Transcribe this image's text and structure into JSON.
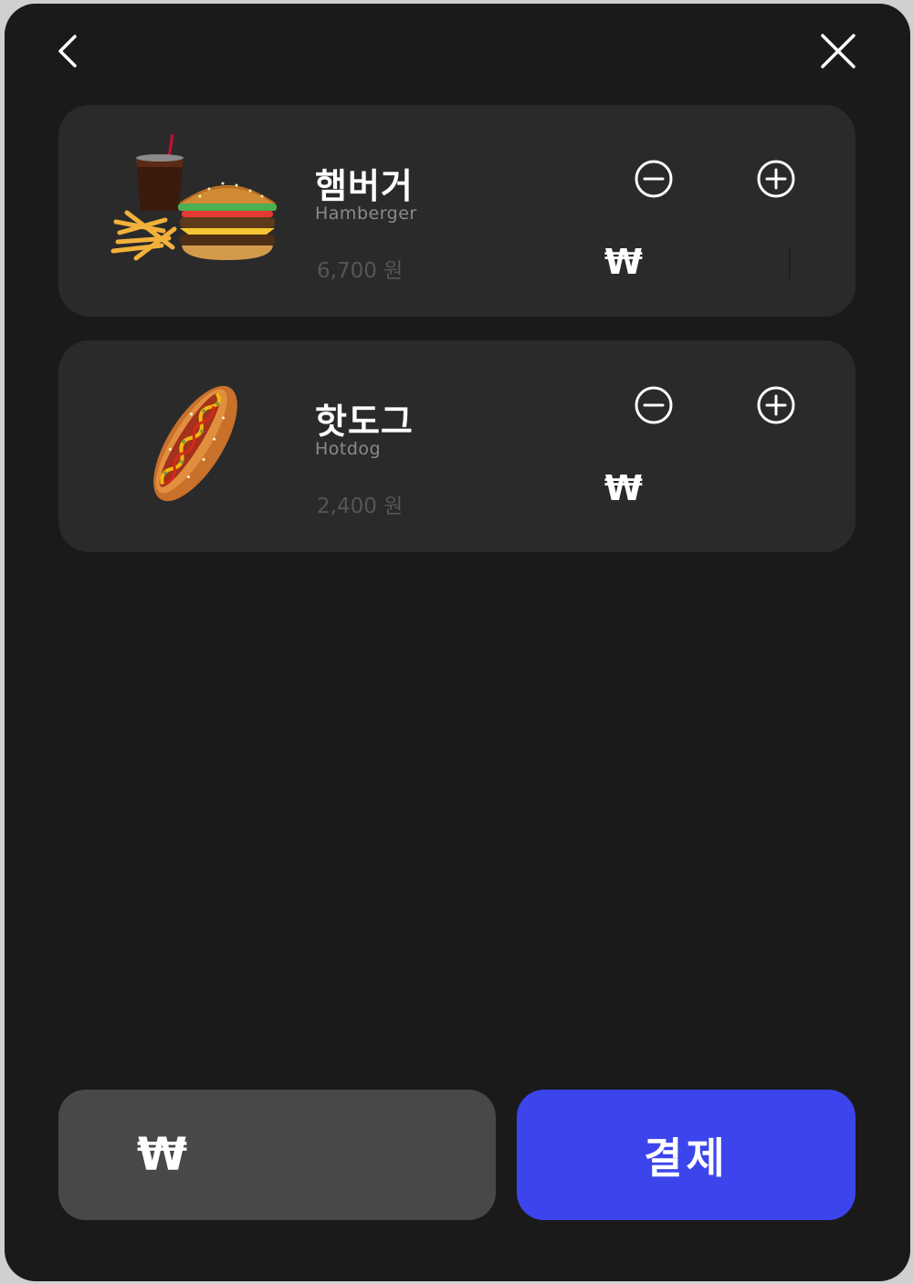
{
  "nav": {
    "back_icon": "chevron-left-icon",
    "close_icon": "close-icon"
  },
  "cart": {
    "items": [
      {
        "name_ko": "햄버거",
        "name_en": "Hamberger",
        "price": "6,700 원",
        "currency_symbol": "₩",
        "image": "burger-set-image"
      },
      {
        "name_ko": "핫도그",
        "name_en": "Hotdog",
        "price": "2,400 원",
        "currency_symbol": "₩",
        "image": "hotdog-image"
      }
    ]
  },
  "footer": {
    "total_symbol": "₩",
    "pay_label": "결제"
  },
  "colors": {
    "background": "#1a1a1a",
    "card": "#2a2a2b",
    "total_box": "#484848",
    "pay_button": "#3c45ec"
  }
}
